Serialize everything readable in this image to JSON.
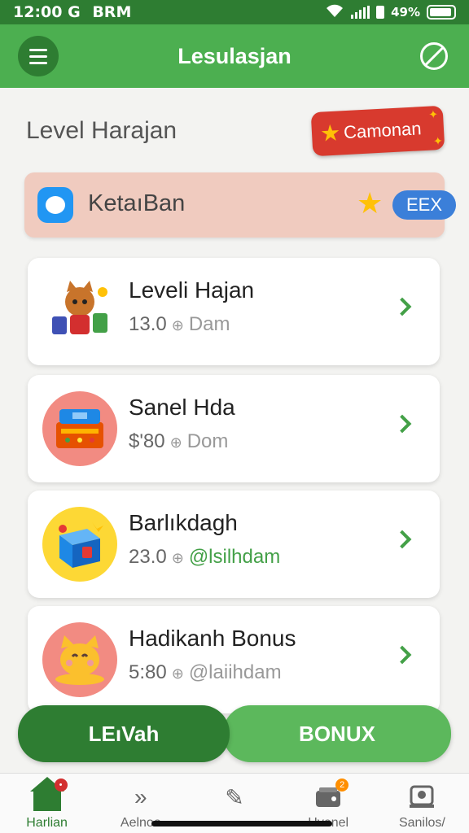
{
  "status_bar": {
    "time": "12:00 G",
    "carrier": "BRM",
    "extra": "49%"
  },
  "app_bar": {
    "title": "Lesulasjan"
  },
  "level_header": "Level Harajan",
  "campaign_badge": "Camonan",
  "banner": {
    "label": "KetaıBan",
    "pill": "EEX"
  },
  "cards": [
    {
      "title": "Leveli Hajan",
      "value": "13.0",
      "sub": "Dam",
      "icon": "cat-character-icon"
    },
    {
      "title": "Sanel Hda",
      "value": "$'80",
      "sub": "Dom",
      "icon": "treasure-chest-icon"
    },
    {
      "title": "Barlıkdagh",
      "value": "23.0",
      "sub": "@lsilhdam",
      "icon": "gift-box-icon"
    },
    {
      "title": "Hadikanh Bonus",
      "value": "5:80",
      "sub": "@laiihdam",
      "icon": "cat-face-icon"
    }
  ],
  "actions": {
    "left": "LEıVah",
    "right": "BONUX"
  },
  "bottom_nav": [
    {
      "label": "Harlian",
      "icon": "home-icon",
      "badge": ""
    },
    {
      "label": "Aelnoo",
      "icon": "forward-icon",
      "badge": ""
    },
    {
      "label": "",
      "icon": "pin-icon",
      "badge": ""
    },
    {
      "label": "Hvenel",
      "icon": "wallet-icon",
      "badge": "2"
    },
    {
      "label": "Sanilos/",
      "icon": "profile-icon",
      "badge": ""
    }
  ],
  "colors": {
    "primary": "#4caf50",
    "primary_dark": "#2e7d32",
    "accent_red": "#d83a2e",
    "banner_bg": "#f0cbbf"
  }
}
